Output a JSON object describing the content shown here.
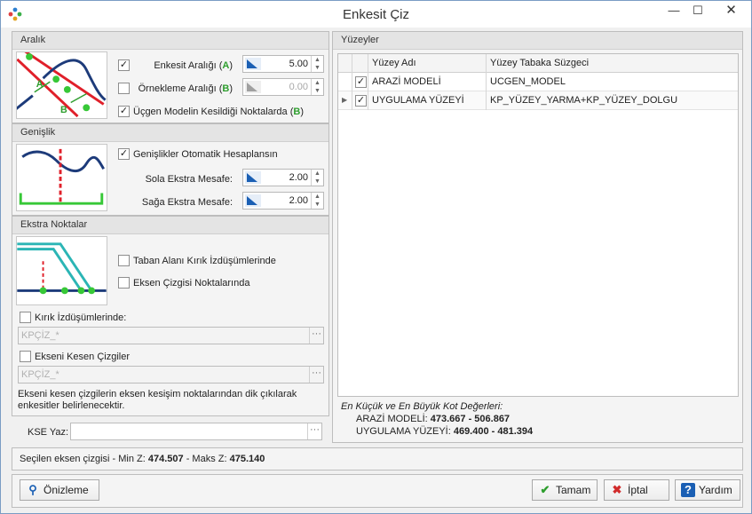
{
  "window": {
    "title": "Enkesit Çiz",
    "min": "—",
    "max": "☐",
    "close": "✕"
  },
  "aralik": {
    "header": "Aralık",
    "enkesit": {
      "label": "Enkesit Aralığı (",
      "letter": "A",
      "close": ")",
      "checked": true,
      "value": "5.00"
    },
    "ornekleme": {
      "label": "Örnekleme Aralığı (",
      "letter": "B",
      "close": ")",
      "checked": false,
      "value": "0.00"
    },
    "ucgen": {
      "label": "Üçgen Modelin Kesildiği Noktalarda (",
      "letter": "B",
      "close": ")",
      "checked": true
    },
    "diagram_labels": {
      "a": "A",
      "b": "B"
    }
  },
  "genislik": {
    "header": "Genişlik",
    "otomatik": {
      "label": "Genişlikler Otomatik Hesaplansın",
      "checked": true
    },
    "sola": {
      "label": "Sola Ekstra Mesafe:",
      "value": "2.00"
    },
    "saga": {
      "label": "Sağa Ekstra Mesafe:",
      "value": "2.00"
    }
  },
  "ekstra": {
    "header": "Ekstra Noktalar",
    "taban": {
      "label": "Taban Alanı Kırık İzdüşümlerinde",
      "checked": false
    },
    "eksen": {
      "label": "Eksen Çizgisi Noktalarında",
      "checked": false
    },
    "kirik": {
      "label": "Kırık İzdüşümlerinde:",
      "checked": false,
      "value": "KPÇİZ_*"
    },
    "kesen": {
      "label": "Ekseni Kesen Çizgiler",
      "checked": false,
      "value": "KPÇİZ_*"
    },
    "note_line1": "Ekseni kesen çizgilerin eksen kesişim noktalarından dik çıkılarak",
    "note_line2": "enkesitler belirlenecektir."
  },
  "kse": {
    "label": "KSE Yaz:",
    "value": ""
  },
  "yuzeyler": {
    "header": "Yüzeyler",
    "columns": {
      "name": "Yüzey Adı",
      "filter": "Yüzey Tabaka Süzgeci"
    },
    "rows": [
      {
        "checked": true,
        "name": "ARAZİ MODELİ",
        "filter": "UCGEN_MODEL",
        "selected": false
      },
      {
        "checked": true,
        "name": "UYGULAMA YÜZEYİ",
        "filter": "KP_YÜZEY_YARMA+KP_YÜZEY_DOLGU",
        "selected": true
      }
    ],
    "minmax_title": "En Küçük ve En Büyük Kot Değerleri:",
    "minmax": [
      {
        "label": "ARAZİ MODELİ: ",
        "value": "473.667 - 506.867"
      },
      {
        "label": "UYGULAMA YÜZEYİ: ",
        "value": "469.400 - 481.394"
      }
    ]
  },
  "status": {
    "prefix": "Seçilen eksen çizgisi - Min Z: ",
    "min": "474.507",
    "mid": " - Maks Z: ",
    "max": "475.140"
  },
  "buttons": {
    "preview": "Önizleme",
    "ok": "Tamam",
    "cancel": "İptal",
    "help": "Yardım"
  },
  "colors": {
    "accent_blue": "#1a5fb4",
    "ok_green": "#2e9e2e",
    "cancel_red": "#d12b2b",
    "diagram_red": "#e0202a",
    "diagram_green": "#37c837",
    "diagram_teal": "#2bb5b5",
    "diagram_navy": "#1d3b7a"
  }
}
